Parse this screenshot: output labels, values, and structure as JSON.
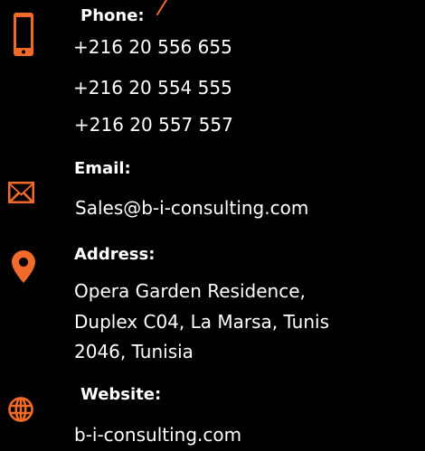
{
  "accent_color": "#F06A2A",
  "text_color": "#FFFFFF",
  "background_color": "#000000",
  "phone": {
    "icon": "phone-icon",
    "label": "Phone:",
    "numbers": [
      "+216 20 556 655",
      "+216 20 554 555",
      "+216 20 557 557"
    ]
  },
  "email": {
    "icon": "envelope-icon",
    "label": "Email:",
    "value": "Sales@b-i-consulting.com"
  },
  "address": {
    "icon": "map-pin-icon",
    "label": "Address:",
    "lines": [
      "Opera Garden Residence,",
      "Duplex C04, La Marsa, Tunis",
      "2046, Tunisia"
    ]
  },
  "website": {
    "icon": "globe-icon",
    "label": "Website:",
    "value": "b-i-consulting.com"
  }
}
